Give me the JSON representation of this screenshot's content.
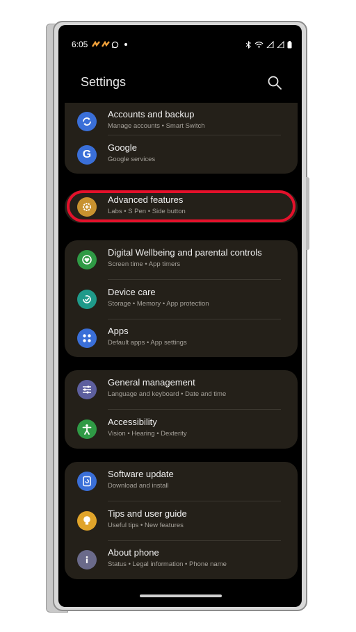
{
  "status_bar": {
    "time": "6:05"
  },
  "header": {
    "title": "Settings"
  },
  "items": [
    {
      "label": "Accounts and backup",
      "sub": "Manage accounts  •  Smart Switch",
      "icon": "sync-icon",
      "color": "#3a6fd8"
    },
    {
      "label": "Google",
      "sub": "Google services",
      "icon": "google-g-icon",
      "color": "#3a6fd8"
    },
    {
      "label": "Advanced features",
      "sub": "Labs  •  S Pen  •  Side button",
      "icon": "gear-plus-icon",
      "color": "#c8922f"
    },
    {
      "label": "Digital Wellbeing and parental controls",
      "sub": "Screen time  •  App timers",
      "icon": "heart-circle-icon",
      "color": "#2f9a45"
    },
    {
      "label": "Device care",
      "sub": "Storage  •  Memory  •  App protection",
      "icon": "device-care-icon",
      "color": "#1f9a8a"
    },
    {
      "label": "Apps",
      "sub": "Default apps  •  App settings",
      "icon": "apps-grid-icon",
      "color": "#3a6fd8"
    },
    {
      "label": "General management",
      "sub": "Language and keyboard  •  Date and time",
      "icon": "sliders-icon",
      "color": "#5d5f9e"
    },
    {
      "label": "Accessibility",
      "sub": "Vision  •  Hearing  •  Dexterity",
      "icon": "accessibility-person-icon",
      "color": "#2f9a45"
    },
    {
      "label": "Software update",
      "sub": "Download and install",
      "icon": "software-update-icon",
      "color": "#3a6fd8"
    },
    {
      "label": "Tips and user guide",
      "sub": "Useful tips  •  New features",
      "icon": "lightbulb-icon",
      "color": "#e0a42a"
    },
    {
      "label": "About phone",
      "sub": "Status  •  Legal information  •  Phone name",
      "icon": "info-icon",
      "color": "#6a6a8a"
    }
  ],
  "accent": {
    "highlight": "#e3112b"
  }
}
